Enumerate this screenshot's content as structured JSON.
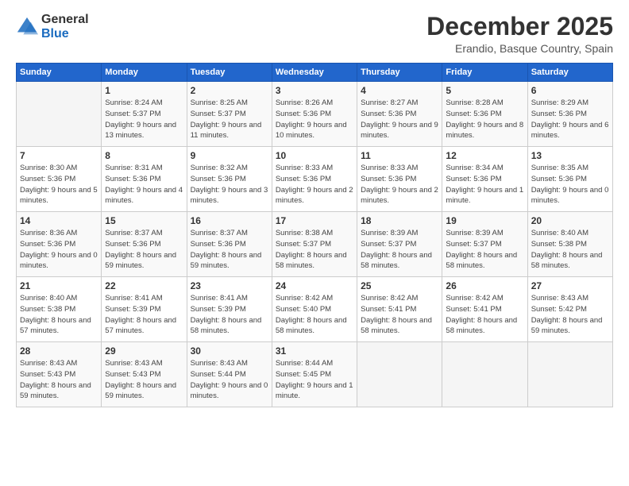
{
  "logo": {
    "general": "General",
    "blue": "Blue"
  },
  "header": {
    "month": "December 2025",
    "location": "Erandio, Basque Country, Spain"
  },
  "weekdays": [
    "Sunday",
    "Monday",
    "Tuesday",
    "Wednesday",
    "Thursday",
    "Friday",
    "Saturday"
  ],
  "weeks": [
    [
      {
        "day": "",
        "sunrise": "",
        "sunset": "",
        "daylight": ""
      },
      {
        "day": "1",
        "sunrise": "Sunrise: 8:24 AM",
        "sunset": "Sunset: 5:37 PM",
        "daylight": "Daylight: 9 hours and 13 minutes."
      },
      {
        "day": "2",
        "sunrise": "Sunrise: 8:25 AM",
        "sunset": "Sunset: 5:37 PM",
        "daylight": "Daylight: 9 hours and 11 minutes."
      },
      {
        "day": "3",
        "sunrise": "Sunrise: 8:26 AM",
        "sunset": "Sunset: 5:36 PM",
        "daylight": "Daylight: 9 hours and 10 minutes."
      },
      {
        "day": "4",
        "sunrise": "Sunrise: 8:27 AM",
        "sunset": "Sunset: 5:36 PM",
        "daylight": "Daylight: 9 hours and 9 minutes."
      },
      {
        "day": "5",
        "sunrise": "Sunrise: 8:28 AM",
        "sunset": "Sunset: 5:36 PM",
        "daylight": "Daylight: 9 hours and 8 minutes."
      },
      {
        "day": "6",
        "sunrise": "Sunrise: 8:29 AM",
        "sunset": "Sunset: 5:36 PM",
        "daylight": "Daylight: 9 hours and 6 minutes."
      }
    ],
    [
      {
        "day": "7",
        "sunrise": "Sunrise: 8:30 AM",
        "sunset": "Sunset: 5:36 PM",
        "daylight": "Daylight: 9 hours and 5 minutes."
      },
      {
        "day": "8",
        "sunrise": "Sunrise: 8:31 AM",
        "sunset": "Sunset: 5:36 PM",
        "daylight": "Daylight: 9 hours and 4 minutes."
      },
      {
        "day": "9",
        "sunrise": "Sunrise: 8:32 AM",
        "sunset": "Sunset: 5:36 PM",
        "daylight": "Daylight: 9 hours and 3 minutes."
      },
      {
        "day": "10",
        "sunrise": "Sunrise: 8:33 AM",
        "sunset": "Sunset: 5:36 PM",
        "daylight": "Daylight: 9 hours and 2 minutes."
      },
      {
        "day": "11",
        "sunrise": "Sunrise: 8:33 AM",
        "sunset": "Sunset: 5:36 PM",
        "daylight": "Daylight: 9 hours and 2 minutes."
      },
      {
        "day": "12",
        "sunrise": "Sunrise: 8:34 AM",
        "sunset": "Sunset: 5:36 PM",
        "daylight": "Daylight: 9 hours and 1 minute."
      },
      {
        "day": "13",
        "sunrise": "Sunrise: 8:35 AM",
        "sunset": "Sunset: 5:36 PM",
        "daylight": "Daylight: 9 hours and 0 minutes."
      }
    ],
    [
      {
        "day": "14",
        "sunrise": "Sunrise: 8:36 AM",
        "sunset": "Sunset: 5:36 PM",
        "daylight": "Daylight: 9 hours and 0 minutes."
      },
      {
        "day": "15",
        "sunrise": "Sunrise: 8:37 AM",
        "sunset": "Sunset: 5:36 PM",
        "daylight": "Daylight: 8 hours and 59 minutes."
      },
      {
        "day": "16",
        "sunrise": "Sunrise: 8:37 AM",
        "sunset": "Sunset: 5:36 PM",
        "daylight": "Daylight: 8 hours and 59 minutes."
      },
      {
        "day": "17",
        "sunrise": "Sunrise: 8:38 AM",
        "sunset": "Sunset: 5:37 PM",
        "daylight": "Daylight: 8 hours and 58 minutes."
      },
      {
        "day": "18",
        "sunrise": "Sunrise: 8:39 AM",
        "sunset": "Sunset: 5:37 PM",
        "daylight": "Daylight: 8 hours and 58 minutes."
      },
      {
        "day": "19",
        "sunrise": "Sunrise: 8:39 AM",
        "sunset": "Sunset: 5:37 PM",
        "daylight": "Daylight: 8 hours and 58 minutes."
      },
      {
        "day": "20",
        "sunrise": "Sunrise: 8:40 AM",
        "sunset": "Sunset: 5:38 PM",
        "daylight": "Daylight: 8 hours and 58 minutes."
      }
    ],
    [
      {
        "day": "21",
        "sunrise": "Sunrise: 8:40 AM",
        "sunset": "Sunset: 5:38 PM",
        "daylight": "Daylight: 8 hours and 57 minutes."
      },
      {
        "day": "22",
        "sunrise": "Sunrise: 8:41 AM",
        "sunset": "Sunset: 5:39 PM",
        "daylight": "Daylight: 8 hours and 57 minutes."
      },
      {
        "day": "23",
        "sunrise": "Sunrise: 8:41 AM",
        "sunset": "Sunset: 5:39 PM",
        "daylight": "Daylight: 8 hours and 58 minutes."
      },
      {
        "day": "24",
        "sunrise": "Sunrise: 8:42 AM",
        "sunset": "Sunset: 5:40 PM",
        "daylight": "Daylight: 8 hours and 58 minutes."
      },
      {
        "day": "25",
        "sunrise": "Sunrise: 8:42 AM",
        "sunset": "Sunset: 5:41 PM",
        "daylight": "Daylight: 8 hours and 58 minutes."
      },
      {
        "day": "26",
        "sunrise": "Sunrise: 8:42 AM",
        "sunset": "Sunset: 5:41 PM",
        "daylight": "Daylight: 8 hours and 58 minutes."
      },
      {
        "day": "27",
        "sunrise": "Sunrise: 8:43 AM",
        "sunset": "Sunset: 5:42 PM",
        "daylight": "Daylight: 8 hours and 59 minutes."
      }
    ],
    [
      {
        "day": "28",
        "sunrise": "Sunrise: 8:43 AM",
        "sunset": "Sunset: 5:43 PM",
        "daylight": "Daylight: 8 hours and 59 minutes."
      },
      {
        "day": "29",
        "sunrise": "Sunrise: 8:43 AM",
        "sunset": "Sunset: 5:43 PM",
        "daylight": "Daylight: 8 hours and 59 minutes."
      },
      {
        "day": "30",
        "sunrise": "Sunrise: 8:43 AM",
        "sunset": "Sunset: 5:44 PM",
        "daylight": "Daylight: 9 hours and 0 minutes."
      },
      {
        "day": "31",
        "sunrise": "Sunrise: 8:44 AM",
        "sunset": "Sunset: 5:45 PM",
        "daylight": "Daylight: 9 hours and 1 minute."
      },
      {
        "day": "",
        "sunrise": "",
        "sunset": "",
        "daylight": ""
      },
      {
        "day": "",
        "sunrise": "",
        "sunset": "",
        "daylight": ""
      },
      {
        "day": "",
        "sunrise": "",
        "sunset": "",
        "daylight": ""
      }
    ]
  ]
}
